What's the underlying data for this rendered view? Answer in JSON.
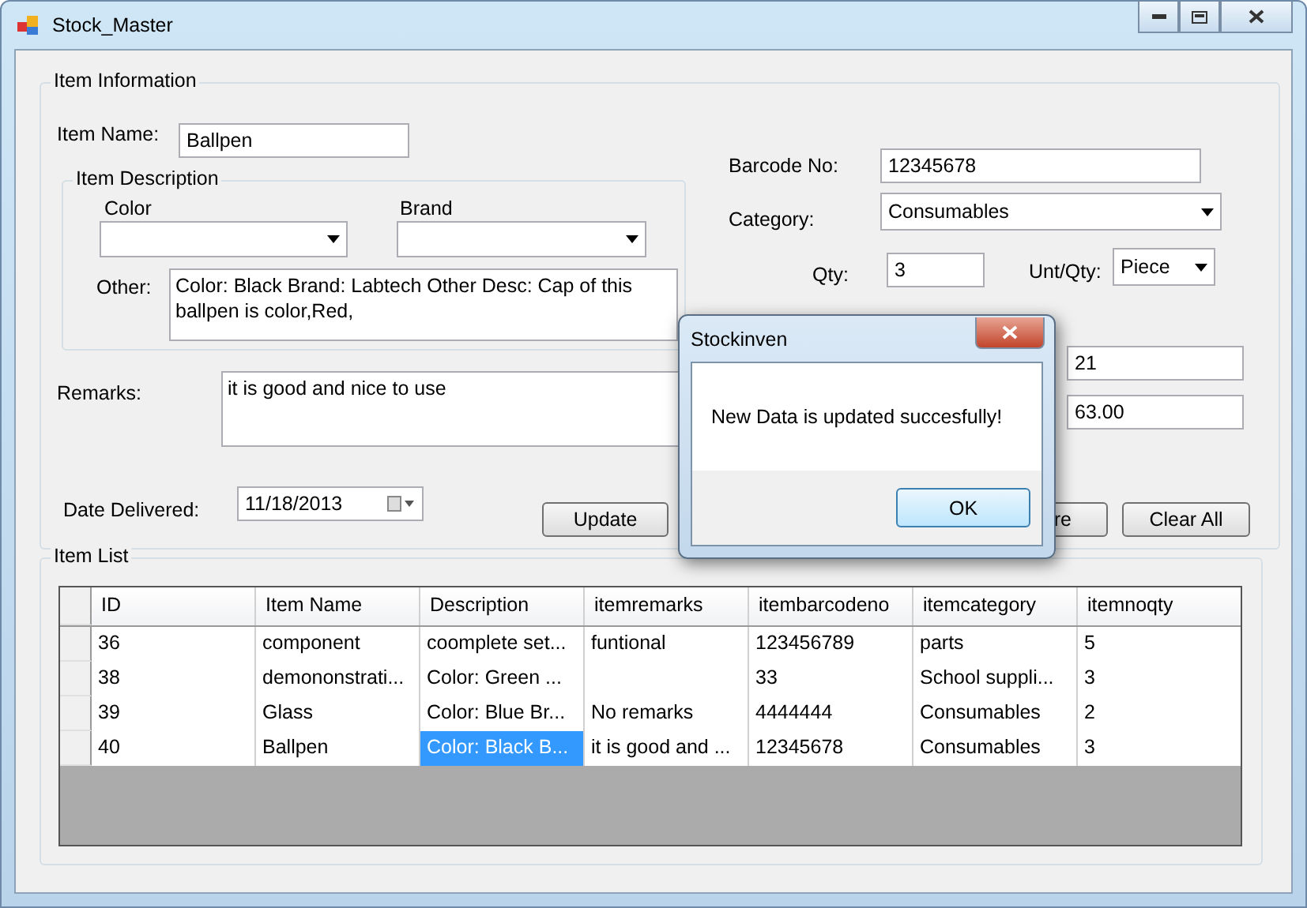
{
  "window": {
    "title": "Stock_Master"
  },
  "item_information": {
    "title": "Item Information",
    "item_name": {
      "label": "Item Name:",
      "value": "Ballpen"
    },
    "item_description": {
      "title": "Item Description",
      "color": {
        "label": "Color"
      },
      "brand": {
        "label": "Brand"
      },
      "other": {
        "label": "Other:",
        "value": "Color: Black Brand: Labtech Other Desc: Cap of this ballpen is color,Red,"
      }
    },
    "remarks": {
      "label": "Remarks:",
      "value": "it is good and nice to use"
    },
    "date_delivered": {
      "label": "Date Delivered:",
      "value": "11/18/2013"
    },
    "barcode": {
      "label": "Barcode No:",
      "value": "12345678"
    },
    "category": {
      "label": "Category:",
      "value": "Consumables"
    },
    "qty": {
      "label": "Qty:",
      "value": "3"
    },
    "unit_qty": {
      "label": "Unt/Qty:",
      "value": "Piece"
    },
    "field_5": {
      "value": "21"
    },
    "field_6": {
      "value": "63.00"
    },
    "buttons": [
      {
        "label": "Update"
      },
      {
        "label": "re"
      },
      {
        "label": "Clear All"
      }
    ]
  },
  "item_list": {
    "title": "Item List",
    "columns": [
      "ID",
      "Item Name",
      "Description",
      "itemremarks",
      "itembarcodeno",
      "itemcategory",
      "itemnoqty"
    ],
    "rows": [
      [
        {
          "text": "36",
          "selected": false
        },
        {
          "text": "component",
          "selected": false
        },
        {
          "text": "coomplete set...",
          "selected": false
        },
        {
          "text": "funtional",
          "selected": false
        },
        {
          "text": "123456789",
          "selected": false
        },
        {
          "text": "parts",
          "selected": false
        },
        {
          "text": "5",
          "selected": false
        }
      ],
      [
        {
          "text": "38",
          "selected": false
        },
        {
          "text": "demononstrati...",
          "selected": false
        },
        {
          "text": "Color: Green ...",
          "selected": false
        },
        {
          "text": "",
          "selected": false
        },
        {
          "text": "33",
          "selected": false
        },
        {
          "text": "School suppli...",
          "selected": false
        },
        {
          "text": "3",
          "selected": false
        }
      ],
      [
        {
          "text": "39",
          "selected": false
        },
        {
          "text": "Glass",
          "selected": false
        },
        {
          "text": "Color: Blue Br...",
          "selected": false
        },
        {
          "text": "No remarks",
          "selected": false
        },
        {
          "text": "4444444",
          "selected": false
        },
        {
          "text": "Consumables",
          "selected": false
        },
        {
          "text": "2",
          "selected": false
        }
      ],
      [
        {
          "text": "40",
          "selected": false
        },
        {
          "text": "Ballpen",
          "selected": false
        },
        {
          "text": "Color: Black B...",
          "selected": true
        },
        {
          "text": "it is good and ...",
          "selected": false
        },
        {
          "text": "12345678",
          "selected": false
        },
        {
          "text": "Consumables",
          "selected": false
        },
        {
          "text": "3",
          "selected": false
        }
      ]
    ]
  },
  "dialog": {
    "title": "Stockinven",
    "message": "New Data is updated succesfully!",
    "button": "OK"
  }
}
